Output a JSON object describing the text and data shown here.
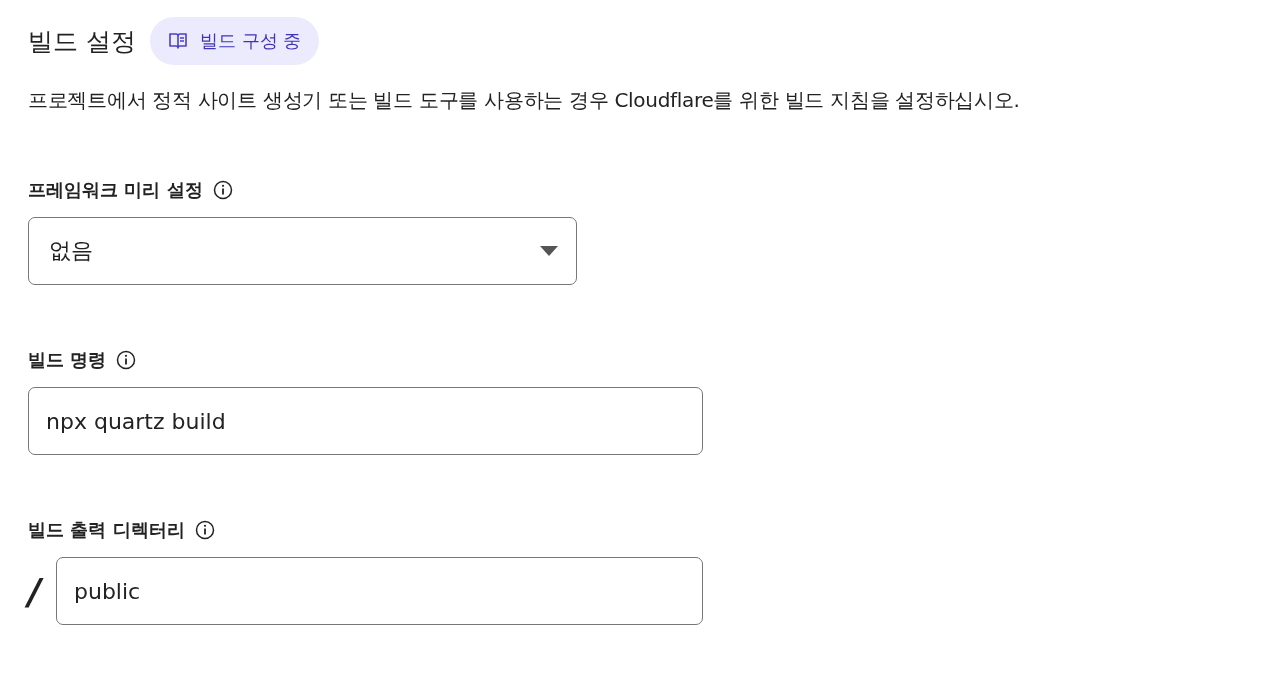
{
  "header": {
    "title": "빌드 설정",
    "badge": "빌드 구성 중"
  },
  "description": "프로젝트에서 정적 사이트 생성기 또는 빌드 도구를 사용하는 경우 Cloudflare를 위한 빌드 지침을 설정하십시오.",
  "fields": [
    {
      "kind": "select",
      "label": "프레임워크 미리 설정",
      "value": "없음"
    },
    {
      "kind": "text",
      "label": "빌드 명령",
      "value": "npx quartz build"
    },
    {
      "kind": "prefixed",
      "label": "빌드 출력 디렉터리",
      "prefix": "/",
      "value": "public"
    }
  ]
}
